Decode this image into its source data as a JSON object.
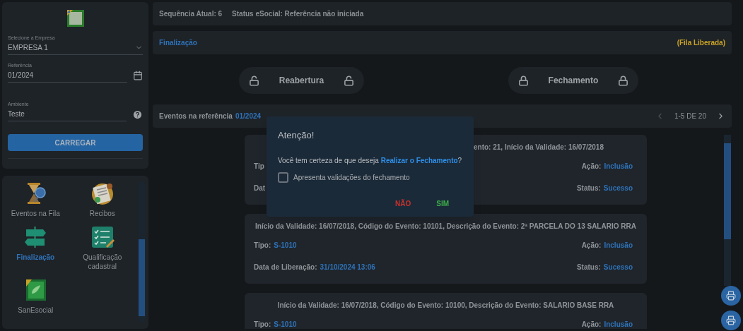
{
  "sidebar": {
    "company": {
      "label": "Selecione a Empresa",
      "value": "EMPRESA 1"
    },
    "reference": {
      "label": "Referência",
      "value": "01/2024"
    },
    "environment": {
      "label": "Ambiente",
      "value": "Teste"
    },
    "load_button": "CARREGAR",
    "menu": [
      {
        "label": "Eventos na Fila",
        "kind": "hourglass",
        "selected": false
      },
      {
        "label": "Recibos",
        "kind": "receipt",
        "selected": false
      },
      {
        "label": "Finalização",
        "kind": "signpost",
        "selected": true
      },
      {
        "label": "Qualificação cadastral",
        "kind": "checklist",
        "selected": false
      },
      {
        "label": "SanEsocial",
        "kind": "leaf",
        "selected": false
      }
    ]
  },
  "header": {
    "sequence": "Sequência Atual: 6",
    "status": "Status eSocial: Referência não iniciada"
  },
  "section": {
    "title": "Finalização",
    "queue_status": "(Fila Liberada)"
  },
  "actions": [
    {
      "label": "Reabertura",
      "locked": false
    },
    {
      "label": "Fechamento",
      "locked": true
    }
  ],
  "events": {
    "title": "Eventos na referência",
    "reference": "01/2024",
    "pagination": "1-5 DE 20",
    "cards": [
      {
        "kind": "covered",
        "title": "ento: 21, Início da Validade: 16/07/2018",
        "rows": [
          {
            "left": {
              "label": "Tip"
            },
            "right": {
              "label": "Ação:",
              "value": "Inclusão"
            }
          },
          {
            "left": {
              "label": "Dat"
            },
            "right": {
              "label": "Status:",
              "value": "Sucesso"
            }
          }
        ]
      },
      {
        "kind": "full",
        "title": "Início da Validade: 16/07/2018, Código do Evento: 10101, Descrição do Evento: 2ª PARCELA DO 13 SALARIO RRA",
        "rows": [
          {
            "left": {
              "label": "Tipo:",
              "value": "S-1010"
            },
            "right": {
              "label": "Ação:",
              "value": "Inclusão"
            }
          },
          {
            "left": {
              "label": "Data de Liberação:",
              "value": "31/10/2024 13:06"
            },
            "right": {
              "label": "Status:",
              "value": "Sucesso"
            }
          }
        ]
      },
      {
        "kind": "full",
        "title": "Início da Validade: 16/07/2018, Código do Evento: 10100, Descrição do Evento: SALARIO BASE RRA",
        "rows": [
          {
            "left": {
              "label": "Tipo:",
              "value": "S-1010"
            },
            "right": {
              "label": "Ação:",
              "value": "Inclusão"
            }
          }
        ]
      }
    ]
  },
  "dialog": {
    "title": "Atenção!",
    "message": "Você tem certeza de que deseja **Realizar o Fechamento**?",
    "option": {
      "label": "Apresenta validações do fechamento",
      "checked": false
    },
    "buttons": [
      {
        "label": "NÃO",
        "kind": "cancel"
      },
      {
        "label": "SIM",
        "kind": "confirm"
      }
    ]
  }
}
